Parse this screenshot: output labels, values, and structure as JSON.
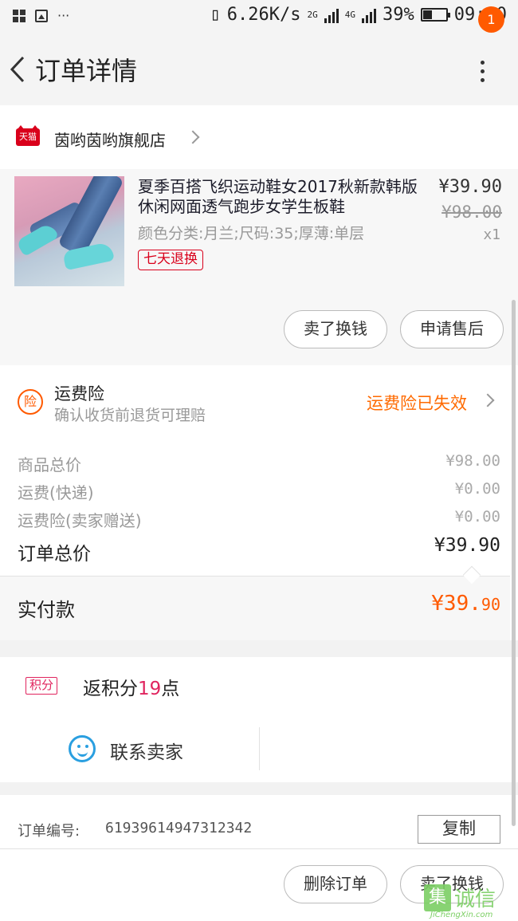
{
  "status_bar": {
    "network_speed": "6.26K/s",
    "signal1": "2G",
    "signal2": "4G",
    "battery": "39%",
    "battery_level": 0.39,
    "time": "09:20"
  },
  "header": {
    "title": "订单详情",
    "badge_count": "1"
  },
  "shop": {
    "platform_icon_text": "天猫",
    "name": "茵哟茵哟旗舰店"
  },
  "product": {
    "title": "夏季百搭飞织运动鞋女2017秋新款韩版休闲网面透气跑步女学生板鞋",
    "spec": "颜色分类:月兰;尺码:35;厚薄:单层",
    "tag": "七天退换",
    "price": "¥39.90",
    "original_price": "¥98.00",
    "quantity": "x1",
    "buttons": {
      "sell_label": "卖了换钱",
      "after_sale_label": "申请售后"
    }
  },
  "insurance": {
    "icon_text": "险",
    "title": "运费险",
    "subtitle": "确认收货前退货可理赔",
    "status": "运费险已失效"
  },
  "summary": {
    "rows": [
      {
        "label": "商品总价",
        "value": "¥98.00"
      },
      {
        "label": "运费(快递)",
        "value": "¥0.00"
      },
      {
        "label": "运费险(卖家赠送)",
        "value": "¥0.00"
      }
    ],
    "total_label": "订单总价",
    "total_value": "¥39.90",
    "paid_label": "实付款",
    "paid_value_main": "¥39.",
    "paid_value_cents": "90"
  },
  "points": {
    "icon_text": "积分",
    "prefix": "返积分",
    "amount": "19",
    "suffix": "点"
  },
  "contact": {
    "label": "联系卖家"
  },
  "order": {
    "number_label": "订单编号:",
    "number": "619396149473123​42",
    "copy_label": "复制"
  },
  "bottom_actions": {
    "delete_label": "删除订单",
    "sell_label": "卖了换钱"
  },
  "watermark": {
    "box_char": "集",
    "text": "诚信",
    "url": "JiChengXin.com"
  },
  "colors": {
    "accent_orange": "#ff5a00",
    "tmall_red": "#d9001b",
    "points_pink": "#e0245e",
    "contact_blue": "#2a9fe0"
  }
}
